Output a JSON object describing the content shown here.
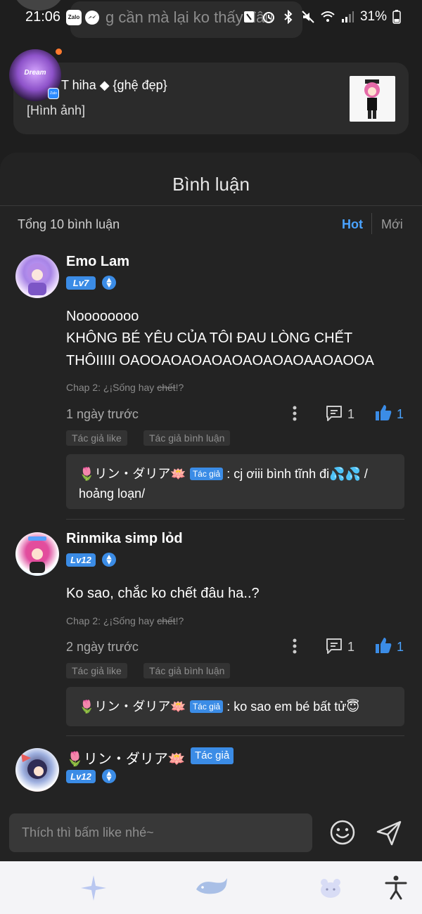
{
  "status_bar": {
    "time": "21:06",
    "zalo_label": "Zalo",
    "battery": "31%",
    "background_notification": "g cần mà lại ko thấy đâu"
  },
  "post": {
    "avatar_text": "Dream",
    "author": "T hiha ◆ {ghệ đẹp}",
    "body": "[Hình ảnh]"
  },
  "comments_sheet": {
    "title": "Bình luận",
    "total": "Tổng 10 bình luận",
    "sort_hot": "Hot",
    "sort_new": "Mới"
  },
  "comments": [
    {
      "name": "Emo Lam",
      "level": "Lv7",
      "text_line1": "Noooooooo",
      "text_line2": "KHÔNG BÉ YÊU CỦA TÔI ĐAU LÒNG CHẾT",
      "text_line3": "THÔIIIII OAOOAOAOAOAOAOAOAOAAOAOOA",
      "chapter_prefix": "Chap 2: ¿¡Sống hay ",
      "chapter_strike": "chết",
      "chapter_suffix": "!?",
      "time": "1 ngày trước",
      "replies": "1",
      "likes": "1",
      "tags": [
        "Tác giả like",
        "Tác giả bình luận"
      ],
      "reply": {
        "author": "🌷リン・ダリア🪷",
        "badge": "Tác giả",
        "text_line1": ": cj ơiii bình tĩnh đi💦💦 /",
        "text_line2": "hoảng loạn/"
      }
    },
    {
      "name": "Rinmika simp lỏd",
      "level": "Lv12",
      "text_line1": "Ko sao, chắc ko chết đâu ha..?",
      "chapter_prefix": "Chap 2: ¿¡Sống hay ",
      "chapter_strike": "chết",
      "chapter_suffix": "!?",
      "time": "2 ngày trước",
      "replies": "1",
      "likes": "1",
      "tags": [
        "Tác giả like",
        "Tác giả bình luận"
      ],
      "reply": {
        "author": "🌷リン・ダリア🪷",
        "badge": "Tác giả",
        "text_line1": ": ko sao em bé bất tử😇"
      }
    },
    {
      "name": "🌷リン・ダリア🪷",
      "badge": "Tác giả",
      "level": "Lv12"
    }
  ],
  "input": {
    "placeholder": "Thích thì bấm like nhé~"
  },
  "colors": {
    "accent": "#3b8ce6",
    "background": "#232323",
    "notification_dot": "#ff7a2f"
  },
  "icons": {
    "nav": [
      "sparkle-icon",
      "whale-icon",
      "bear-icon",
      "accessibility-icon"
    ]
  }
}
